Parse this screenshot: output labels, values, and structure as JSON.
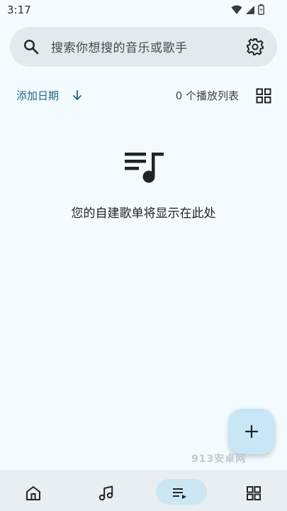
{
  "status_bar": {
    "time": "3:17"
  },
  "search": {
    "placeholder": "搜索你想搜的音乐或歌手"
  },
  "sort": {
    "label": "添加日期"
  },
  "playlists": {
    "count_label": "0 个播放列表"
  },
  "empty_state": {
    "message": "您的自建歌单将显示在此处"
  },
  "watermark": {
    "text": "913安卓网"
  },
  "bottom_nav": {
    "items": [
      {
        "icon": "home-icon",
        "selected": false
      },
      {
        "icon": "music-note-icon",
        "selected": false
      },
      {
        "icon": "playlist-icon",
        "selected": true
      },
      {
        "icon": "grid-icon",
        "selected": false
      }
    ]
  },
  "colors": {
    "accent": "#196883",
    "background": "#f4fbff",
    "fab": "#c7e7f6",
    "nav_selected": "#cde6f3"
  }
}
